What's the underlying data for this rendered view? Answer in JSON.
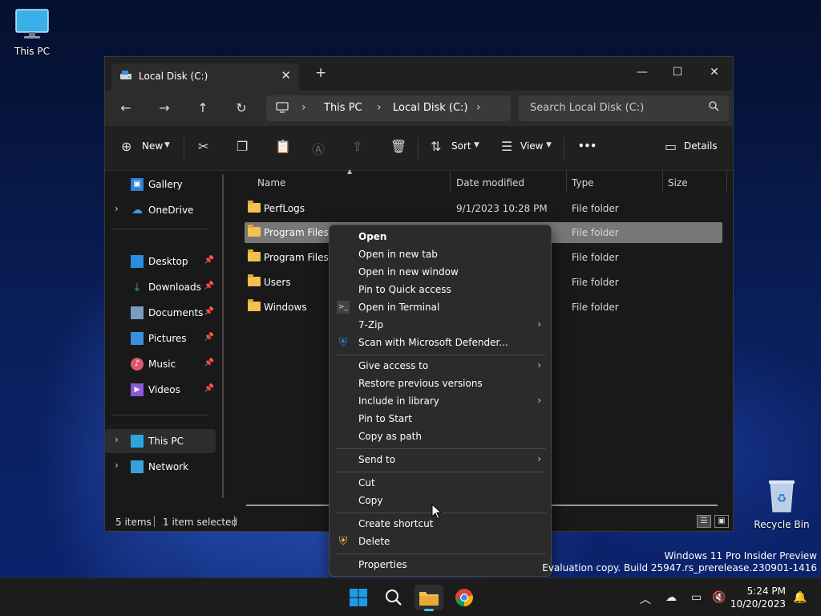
{
  "desktop": {
    "icons": [
      {
        "label": "This PC",
        "icon": "monitor-icon"
      },
      {
        "label": "Recycle Bin",
        "icon": "recycle-bin-icon"
      }
    ],
    "watermark": {
      "line1": "Windows 11 Pro Insider Preview",
      "line2": "Evaluation copy. Build 25947.rs_prerelease.230901-1416"
    }
  },
  "window": {
    "tab_title": "Local Disk (C:)",
    "new_tab": "+",
    "controls": {
      "minimize": "—",
      "maximize": "☐",
      "close": "✕"
    },
    "breadcrumbs": [
      "This PC",
      "Local Disk (C:)"
    ],
    "search_placeholder": "Search Local Disk (C:)",
    "commands": {
      "new": "New",
      "sort": "Sort",
      "view": "View",
      "more": "•••",
      "details": "Details"
    },
    "sidebar": {
      "items": [
        {
          "label": "Gallery",
          "icon": "gallery-icon"
        },
        {
          "label": "OneDrive",
          "icon": "cloud-icon"
        },
        {
          "label": "Desktop",
          "icon": "desktop-icon",
          "pinned": true
        },
        {
          "label": "Downloads",
          "icon": "download-icon",
          "pinned": true
        },
        {
          "label": "Documents",
          "icon": "documents-icon",
          "pinned": true
        },
        {
          "label": "Pictures",
          "icon": "pictures-icon",
          "pinned": true
        },
        {
          "label": "Music",
          "icon": "music-icon",
          "pinned": true
        },
        {
          "label": "Videos",
          "icon": "videos-icon",
          "pinned": true
        },
        {
          "label": "This PC",
          "icon": "pc-icon"
        },
        {
          "label": "Network",
          "icon": "network-icon"
        }
      ]
    },
    "columns": [
      "Name",
      "Date modified",
      "Type",
      "Size"
    ],
    "files": [
      {
        "name": "PerfLogs",
        "date": "9/1/2023 10:28 PM",
        "type": "File folder"
      },
      {
        "name": "Program Files",
        "date": "",
        "type": "File folder"
      },
      {
        "name": "Program Files (x",
        "date": "",
        "type": "File folder"
      },
      {
        "name": "Users",
        "date": "",
        "type": "File folder"
      },
      {
        "name": "Windows",
        "date": "",
        "type": "File folder"
      }
    ],
    "status": {
      "count": "5 items",
      "selected": "1 item selected"
    }
  },
  "context_menu": {
    "items": [
      {
        "label": "Open"
      },
      {
        "label": "Open in new tab"
      },
      {
        "label": "Open in new window"
      },
      {
        "label": "Pin to Quick access"
      },
      {
        "label": "Open in Terminal"
      },
      {
        "label": "7-Zip"
      },
      {
        "label": "Scan with Microsoft Defender..."
      },
      {
        "label": "Give access to"
      },
      {
        "label": "Restore previous versions"
      },
      {
        "label": "Include in library"
      },
      {
        "label": "Pin to Start"
      },
      {
        "label": "Copy as path"
      },
      {
        "label": "Send to"
      },
      {
        "label": "Cut"
      },
      {
        "label": "Copy"
      },
      {
        "label": "Create shortcut"
      },
      {
        "label": "Delete"
      },
      {
        "label": "Properties"
      }
    ]
  },
  "taskbar": {
    "time": "5:24 PM",
    "date": "10/20/2023"
  },
  "colors": {
    "accent": "#4cc2ff",
    "folder": "#f2c14e",
    "selection": "#777777"
  }
}
